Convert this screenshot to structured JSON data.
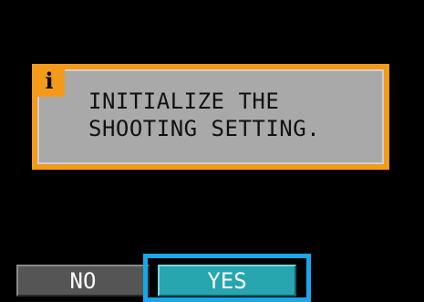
{
  "dialog": {
    "icon": "info-icon",
    "icon_glyph": "i",
    "message_lines": [
      "INITIALIZE THE",
      "SHOOTING SETTING."
    ]
  },
  "options": {
    "no_label": "NO",
    "yes_label": "YES",
    "selected": "YES"
  },
  "colors": {
    "background": "#000000",
    "dialog_border": "#f39a1a",
    "dialog_fill": "#a9a9a9",
    "no_button": "#555555",
    "yes_button": "#27a6b0",
    "selection_frame": "#1aa7e8"
  }
}
